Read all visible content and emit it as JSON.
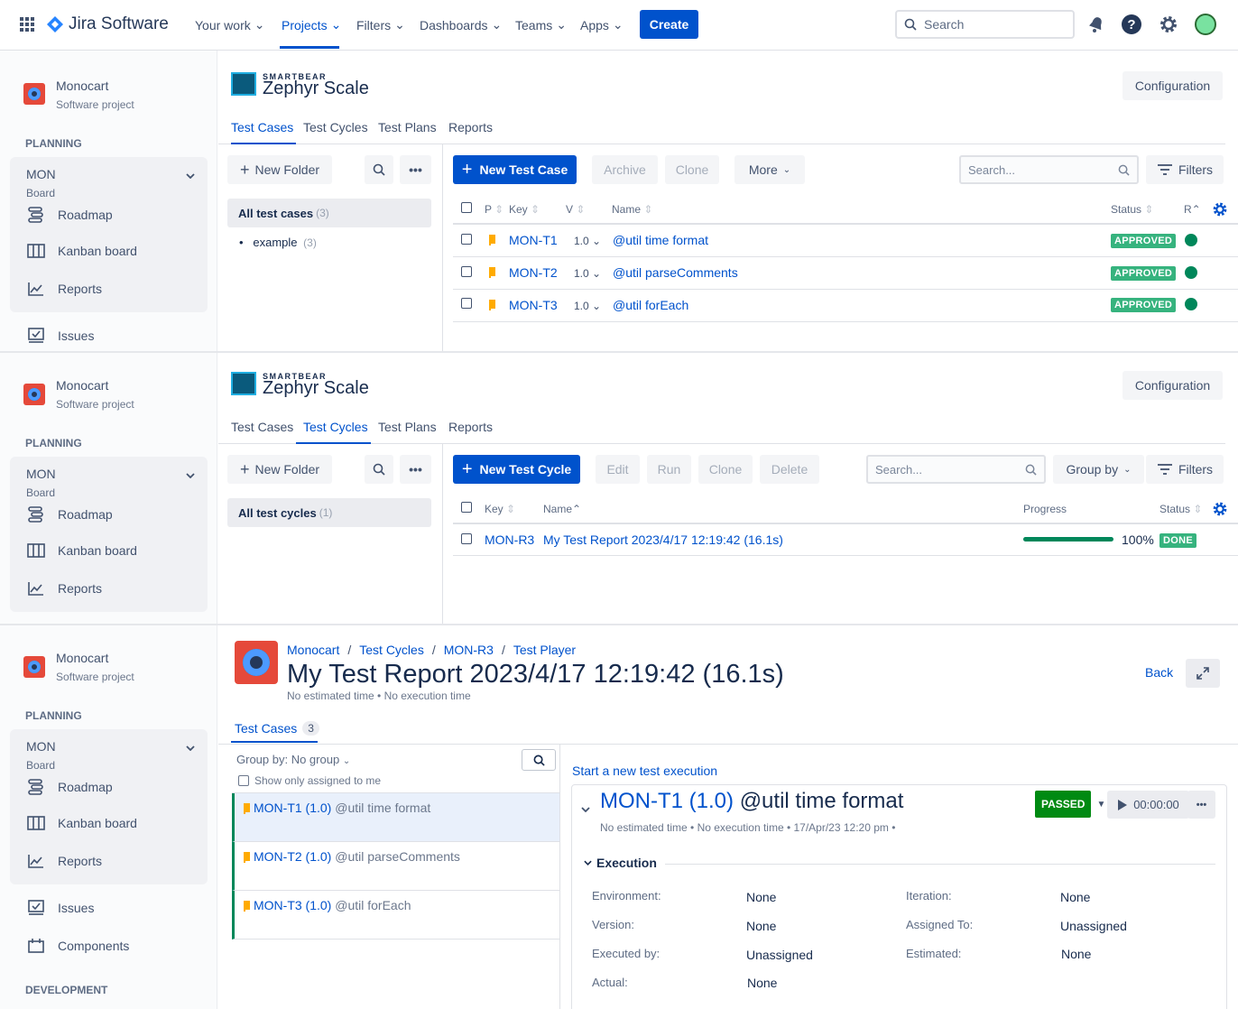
{
  "nav": {
    "logo": "Jira Software",
    "items": [
      "Your work",
      "Projects",
      "Filters",
      "Dashboards",
      "Teams",
      "Apps"
    ],
    "create": "Create",
    "search_placeholder": "Search"
  },
  "project": {
    "name": "Monocart",
    "type": "Software project",
    "planning": "PLANNING",
    "board_name": "MON",
    "board_sub": "Board",
    "links": [
      "Roadmap",
      "Kanban board",
      "Reports"
    ],
    "issues": "Issues",
    "components": "Components",
    "development": "DEVELOPMENT"
  },
  "zephyr": {
    "brand_small": "SMARTBEAR",
    "brand_big": "Zephyr Scale",
    "configuration": "Configuration",
    "tabs": [
      "Test Cases",
      "Test Cycles",
      "Test Plans",
      "Reports"
    ]
  },
  "test_cases_panel": {
    "new_folder": "New Folder",
    "new_test_case": "New Test Case",
    "archive": "Archive",
    "clone": "Clone",
    "more": "More",
    "search_placeholder": "Search...",
    "filters": "Filters",
    "all_label": "All test cases",
    "all_count": "(3)",
    "folder": "example",
    "folder_count": "(3)",
    "columns": {
      "p": "P",
      "key": "Key",
      "v": "V",
      "name": "Name",
      "status": "Status",
      "r": "R"
    },
    "rows": [
      {
        "key": "MON-T1",
        "ver": "1.0",
        "name": "@util time format",
        "status": "APPROVED"
      },
      {
        "key": "MON-T2",
        "ver": "1.0",
        "name": "@util parseComments",
        "status": "APPROVED"
      },
      {
        "key": "MON-T3",
        "ver": "1.0",
        "name": "@util forEach",
        "status": "APPROVED"
      }
    ]
  },
  "test_cycles_panel": {
    "new_folder": "New Folder",
    "new_test_cycle": "New Test Cycle",
    "edit": "Edit",
    "run": "Run",
    "clone": "Clone",
    "delete": "Delete",
    "search_placeholder": "Search...",
    "group_by": "Group by",
    "filters": "Filters",
    "all_label": "All test cycles",
    "all_count": "(1)",
    "columns": {
      "key": "Key",
      "name": "Name",
      "progress": "Progress",
      "status": "Status"
    },
    "rows": [
      {
        "key": "MON-R3",
        "name": "My Test Report 2023/4/17 12:19:42 (16.1s)",
        "progress_pct": 100,
        "progress_label": "100%",
        "status": "DONE"
      }
    ]
  },
  "player": {
    "breadcrumb": [
      "Monocart",
      "Test Cycles",
      "MON-R3",
      "Test Player"
    ],
    "title": "My Test Report 2023/4/17 12:19:42 (16.1s)",
    "meta": "No estimated time  •  No execution time",
    "back": "Back",
    "tab_label": "Test Cases",
    "tab_count": "3",
    "group_by": "Group by: No group",
    "show_only": "Show only assigned to me",
    "items": [
      {
        "key": "MON-T1 (1.0)",
        "name": "@util time format"
      },
      {
        "key": "MON-T2 (1.0)",
        "name": "@util parseComments"
      },
      {
        "key": "MON-T3 (1.0)",
        "name": "@util forEach"
      }
    ],
    "start_new": "Start a new test execution",
    "detail": {
      "key": "MON-T1 (1.0)",
      "name": "@util time format",
      "meta": "No estimated time  •  No execution time  •  17/Apr/23 12:20 pm  •",
      "status": "PASSED",
      "timer": "00:00:00",
      "section": "Execution",
      "fields_left": [
        {
          "label": "Environment:",
          "value": "None"
        },
        {
          "label": "Version:",
          "value": "None"
        },
        {
          "label": "Executed by:",
          "value": "Unassigned"
        },
        {
          "label": "Actual:",
          "value": "None"
        }
      ],
      "fields_right": [
        {
          "label": "Iteration:",
          "value": "None"
        },
        {
          "label": "Assigned To:",
          "value": "Unassigned"
        },
        {
          "label": "Estimated:",
          "value": "None"
        }
      ]
    }
  }
}
